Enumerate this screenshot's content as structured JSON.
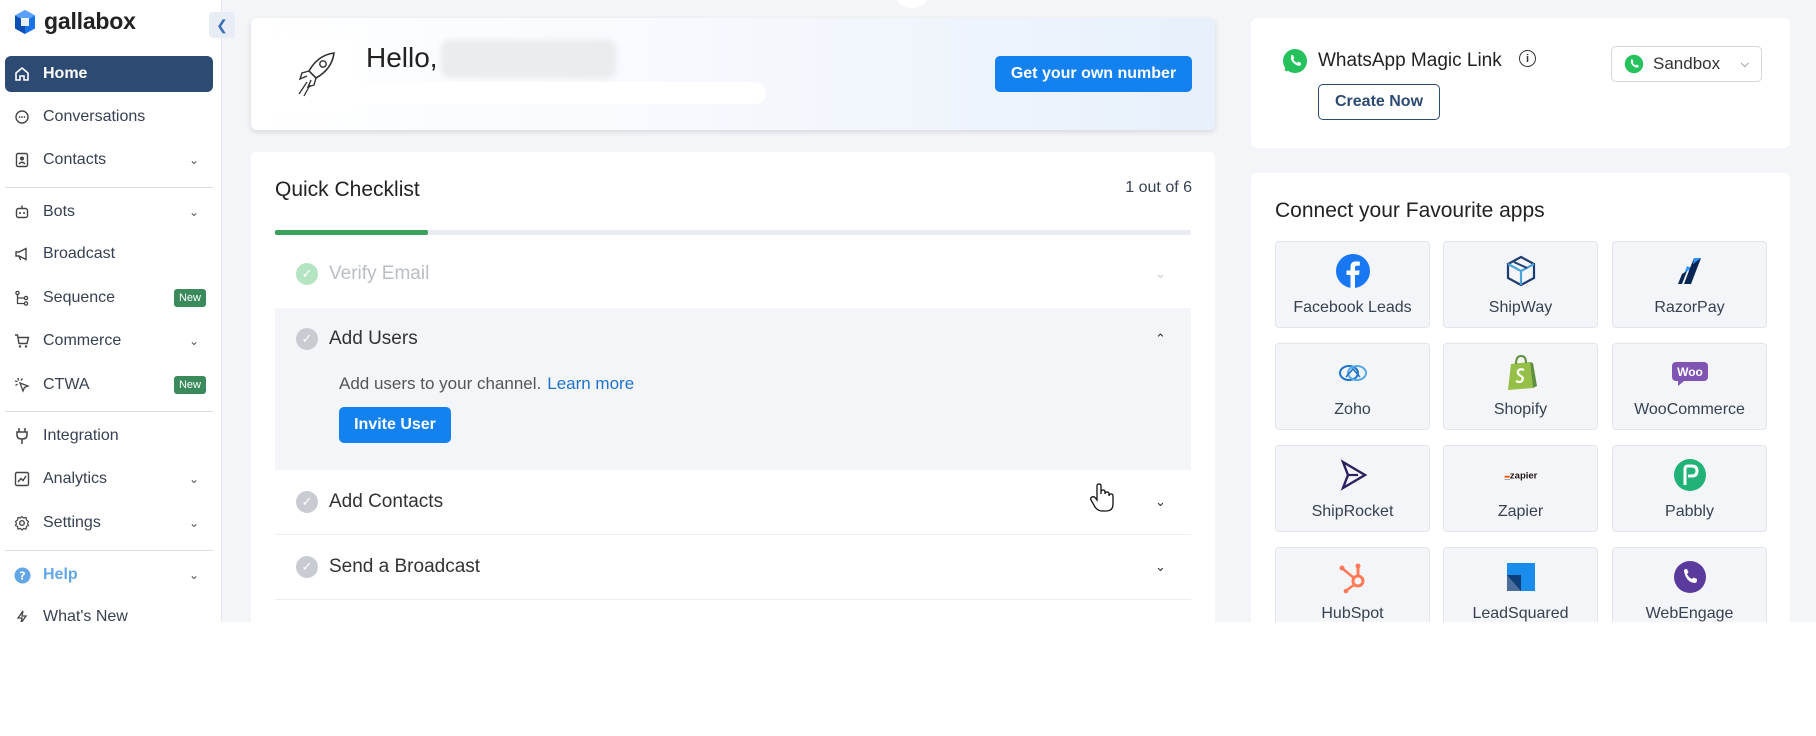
{
  "brand": {
    "name": "gallabox"
  },
  "sidebar": {
    "items": [
      {
        "label": "Home",
        "icon": "home-icon",
        "active": true
      },
      {
        "label": "Conversations",
        "icon": "chat-icon"
      },
      {
        "label": "Contacts",
        "icon": "contacts-icon",
        "expandable": true
      },
      {
        "label": "Bots",
        "icon": "bot-icon",
        "expandable": true
      },
      {
        "label": "Broadcast",
        "icon": "megaphone-icon"
      },
      {
        "label": "Sequence",
        "icon": "sequence-icon",
        "badge": "New"
      },
      {
        "label": "Commerce",
        "icon": "cart-icon",
        "expandable": true
      },
      {
        "label": "CTWA",
        "icon": "click-icon",
        "badge": "New"
      },
      {
        "label": "Integration",
        "icon": "plug-icon"
      },
      {
        "label": "Analytics",
        "icon": "analytics-icon",
        "expandable": true
      },
      {
        "label": "Settings",
        "icon": "settings-icon",
        "expandable": true
      },
      {
        "label": "Help",
        "icon": "help-icon",
        "expandable": true
      },
      {
        "label": "What's New",
        "icon": "bolt-icon"
      }
    ]
  },
  "hello": {
    "greeting": "Hello,",
    "cta": "Get your own number"
  },
  "checklist": {
    "title": "Quick Checklist",
    "count": "1 out of 6",
    "progress": 0.167,
    "items": [
      {
        "label": "Verify Email",
        "done": true
      },
      {
        "label": "Add Users",
        "expanded": true,
        "description": "Add users to your channel.",
        "link": "Learn more",
        "action": "Invite User"
      },
      {
        "label": "Add Contacts"
      },
      {
        "label": "Send a Broadcast"
      }
    ]
  },
  "magic_link": {
    "title": "WhatsApp Magic Link",
    "cta": "Create Now",
    "env": "Sandbox"
  },
  "apps": {
    "title": "Connect your Favourite apps",
    "items": [
      {
        "label": "Facebook Leads",
        "icon": "facebook-icon"
      },
      {
        "label": "ShipWay",
        "icon": "shipway-icon"
      },
      {
        "label": "RazorPay",
        "icon": "razorpay-icon"
      },
      {
        "label": "Zoho",
        "icon": "zoho-icon"
      },
      {
        "label": "Shopify",
        "icon": "shopify-icon"
      },
      {
        "label": "WooCommerce",
        "icon": "woocommerce-icon",
        "logo_text": "Woo"
      },
      {
        "label": "ShipRocket",
        "icon": "shiprocket-icon"
      },
      {
        "label": "Zapier",
        "icon": "zapier-icon",
        "logo_text": "_zapier"
      },
      {
        "label": "Pabbly",
        "icon": "pabbly-icon"
      },
      {
        "label": "HubSpot",
        "icon": "hubspot-icon"
      },
      {
        "label": "LeadSquared",
        "icon": "leadsquared-icon"
      },
      {
        "label": "WebEngage",
        "icon": "webengage-icon"
      }
    ]
  },
  "colors": {
    "primary": "#1481f0",
    "nav_active": "#2d4a73",
    "success": "#3aa05a",
    "new_badge": "#3a8a5c"
  }
}
